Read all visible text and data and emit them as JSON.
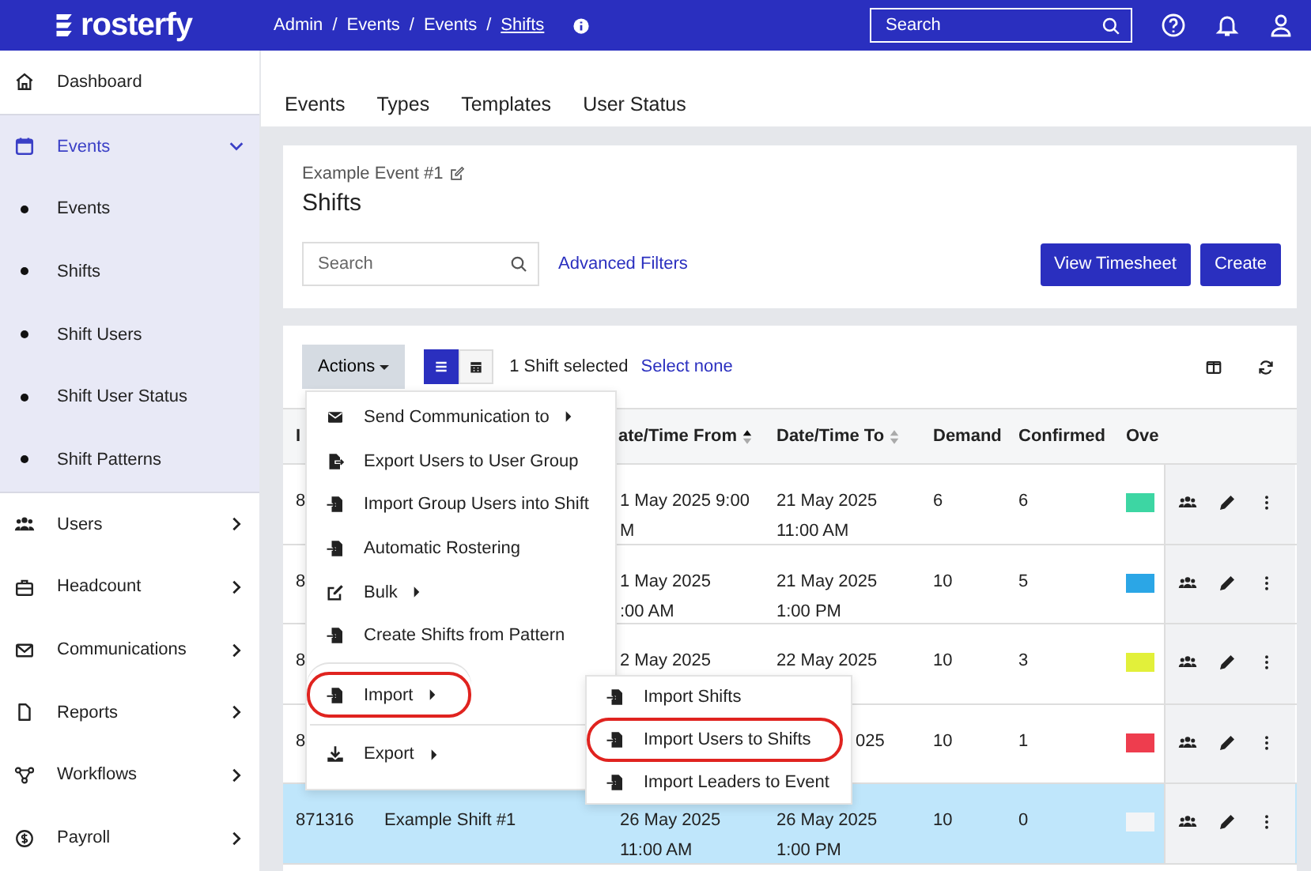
{
  "topbar": {
    "logo": "rosterfy",
    "breadcrumb": [
      {
        "label": "Admin",
        "current": false
      },
      {
        "separator": "/",
        "label": "Events",
        "current": false
      },
      {
        "separator": "/",
        "label": "Events",
        "current": false
      },
      {
        "separator": "/",
        "label": "Shifts",
        "current": true
      }
    ],
    "search": {
      "placeholder": "Search"
    }
  },
  "sidebar": {
    "items": [
      {
        "label": "Dashboard",
        "kind": "link",
        "selected": false
      },
      {
        "label": "Events",
        "kind": "group",
        "selected": true,
        "expanded": true,
        "children": [
          {
            "label": "Events"
          },
          {
            "label": "Shifts"
          },
          {
            "label": "Shift Users"
          },
          {
            "label": "Shift User Status"
          },
          {
            "label": "Shift Patterns"
          }
        ]
      },
      {
        "label": "Users",
        "kind": "group",
        "selected": false,
        "expanded": false
      },
      {
        "label": "Headcount",
        "kind": "group",
        "selected": false,
        "expanded": false
      },
      {
        "label": "Communications",
        "kind": "group",
        "selected": false,
        "expanded": false
      },
      {
        "label": "Reports",
        "kind": "group",
        "selected": false,
        "expanded": false
      },
      {
        "label": "Workflows",
        "kind": "group",
        "selected": false,
        "expanded": false
      },
      {
        "label": "Payroll",
        "kind": "group",
        "selected": false,
        "expanded": false
      }
    ]
  },
  "tabs": [
    {
      "label": "Events"
    },
    {
      "label": "Types"
    },
    {
      "label": "Templates"
    },
    {
      "label": "User Status"
    }
  ],
  "header": {
    "event": "Example Event #1",
    "title": "Shifts",
    "search": {
      "placeholder": "Search"
    },
    "filters_link": "Advanced Filters",
    "buttons": [
      "View Timesheet",
      "Create"
    ]
  },
  "toolbar": {
    "actions": "Actions",
    "view_modes": [
      {
        "selected": true
      },
      {
        "selected": false
      }
    ],
    "selection": "1 Shift selected",
    "select_none": "Select none"
  },
  "table": {
    "columns": [
      {
        "label": "I"
      },
      {
        "label": "ate/Time From",
        "sorted": true
      },
      {
        "label": "Date/Time To",
        "sorted": false
      },
      {
        "label": "Demand"
      },
      {
        "label": "Confirmed"
      },
      {
        "label": "Ove"
      }
    ],
    "rows": [
      {
        "id": "8",
        "from": [
          "1 May 2025 9:00",
          "M"
        ],
        "to": [
          "21 May 2025",
          "11:00 AM"
        ],
        "demand": "6",
        "confirmed": "6",
        "color": "#3dd6a3",
        "selected": false
      },
      {
        "id": "8",
        "from": [
          "1 May 2025",
          ":00 AM"
        ],
        "to": [
          "21 May 2025",
          "1:00 PM"
        ],
        "demand": "10",
        "confirmed": "5",
        "color": "#2ba6e6",
        "selected": false
      },
      {
        "id": "8",
        "from": [
          "2 May 2025"
        ],
        "to": [
          "22 May 2025"
        ],
        "demand": "10",
        "confirmed": "3",
        "color": "#e2f03a",
        "selected": false
      },
      {
        "id": "8",
        "from": [],
        "to": [
          "025"
        ],
        "demand": "10",
        "confirmed": "1",
        "color": "#ee3d4e",
        "selected": false
      },
      {
        "id": "871316",
        "name": "Example Shift #1",
        "from": [
          "26 May 2025",
          "11:00 AM"
        ],
        "to": [
          "26 May 2025",
          "1:00 PM"
        ],
        "demand": "10",
        "confirmed": "0",
        "color": "#f3f4f6",
        "selected": true
      }
    ]
  },
  "actions_menu": {
    "items": [
      {
        "label": "Send Communication to",
        "submenu": true,
        "annotated": false,
        "divider_before": false
      },
      {
        "label": "Export Users to User Group",
        "submenu": false,
        "annotated": false,
        "divider_before": false
      },
      {
        "label": "Import Group Users into Shift",
        "submenu": false,
        "annotated": false,
        "divider_before": false
      },
      {
        "label": "Automatic Rostering",
        "submenu": false,
        "annotated": false,
        "divider_before": false
      },
      {
        "label": "Bulk",
        "submenu": true,
        "annotated": false,
        "divider_before": false
      },
      {
        "label": "Create Shifts from Pattern",
        "submenu": false,
        "annotated": false,
        "divider_before": false
      },
      {
        "label": "Import",
        "submenu": true,
        "annotated": true,
        "divider_before": true
      },
      {
        "label": "Export",
        "submenu": true,
        "annotated": false,
        "divider_before": true
      }
    ]
  },
  "import_submenu": {
    "items": [
      {
        "label": "Import Shifts",
        "annotated": false
      },
      {
        "label": "Import Users to Shifts",
        "annotated": true
      },
      {
        "label": "Import Leaders to Event",
        "annotated": false
      }
    ]
  }
}
